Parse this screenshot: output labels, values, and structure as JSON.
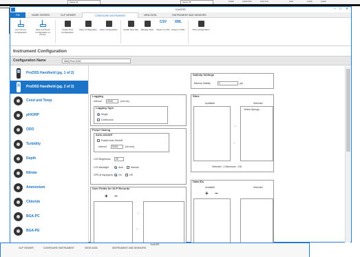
{
  "top_strip": {
    "cells": [
      "Select All",
      "Select All"
    ],
    "numbers": [
      "0.000",
      "0.000 373",
      "0.00 373",
      "6.00",
      "1.000",
      "0.000"
    ]
  },
  "window": {
    "title": "KorDSS",
    "controls": [
      "–",
      "□",
      "✕"
    ]
  },
  "tabs": [
    "File",
    "HOME SCREEN",
    "GLP VIEWER",
    "CONFIGURE INSTRUMENT",
    "VIEW DATA",
    "INSTRUMENT AND SENSORS"
  ],
  "ribbon": {
    "buttons": [
      {
        "label": "Get Current Configuration"
      },
      {
        "label": "Save and Send Configuration to Device"
      },
      {
        "label": "Create New Configuration"
      },
      {
        "label": "Save Configuration"
      },
      {
        "label": "Open Configuration"
      },
      {
        "label": "Create New Site"
      },
      {
        "label": "Manage Sites"
      },
      {
        "label": "Export to CSV",
        "icon_text": "CSV"
      },
      {
        "label": "Export to XML",
        "icon_text": "XML"
      },
      {
        "label": "Print Configuration"
      }
    ]
  },
  "page": {
    "heading": "Instrument Configuration",
    "config_name_label": "Configuration Name",
    "config_name_value": "DMQ Run 2018"
  },
  "sidebar": {
    "items": [
      {
        "label": "ProDSS Handheld (pg. 1 of 2)",
        "kind": "phone"
      },
      {
        "label": "ProDSS Handheld (pg. 2 of 2)",
        "kind": "phone",
        "selected": true
      },
      {
        "label": "Cond and Temp"
      },
      {
        "label": "pH/ORP"
      },
      {
        "label": "ODO"
      },
      {
        "label": "Turbidity"
      },
      {
        "label": "Depth"
      },
      {
        "label": "Nitrate"
      },
      {
        "label": "Ammonium"
      },
      {
        "label": "Chloride"
      },
      {
        "label": "BGA-PC"
      },
      {
        "label": "BGA-PE"
      }
    ]
  },
  "logging": {
    "title": "Logging",
    "interval_label": "Interval",
    "interval_value": "00:00",
    "interval_unit": "(mm:ss)",
    "type_title": "Logging Type",
    "single": "Single",
    "continuous": "Continuous"
  },
  "power": {
    "title": "Power Saving",
    "auto_title": "Auto-shutoff",
    "enable": "Enable Auto Shutoff",
    "interval_label": "Interval",
    "interval_value": "00:05",
    "interval_unit": "(hh:mm)",
    "brightness_label": "LCD Brightness",
    "brightness_value": "25",
    "backlight_label": "LCD Backlight",
    "backlight_auto": "Auto",
    "backlight_manual": "Manual",
    "gps_label": "GPS (if equipped)",
    "gps_on": "On",
    "gps_off": "Off"
  },
  "user_fields": {
    "title": "User Fields for GLP Records",
    "plus": "+",
    "minus": "−",
    "right_arrow": "→",
    "left_arrow": "←"
  },
  "salinity": {
    "title": "Salinity Settings",
    "label": "Backup Salinity",
    "value": "0",
    "unit": "ppt"
  },
  "sites": {
    "title": "Sites",
    "available": "Available",
    "selected": "Selected",
    "selected_item": "Yellow Springs",
    "right_arrow": "→",
    "left_arrow": "←",
    "footer": "Selected : 0    Maximum : 100"
  },
  "data_ids": {
    "title": "Data IDs",
    "available": "Available",
    "selected": "Selected",
    "plus": "+",
    "minus": "−"
  },
  "bottom_window": {
    "title": "KorDSS",
    "tabs": [
      "GLP VIEWER",
      "CONFIGURE INSTRUMENT",
      "VIEW DATA",
      "INSTRUMENT AND SENSORS"
    ]
  }
}
